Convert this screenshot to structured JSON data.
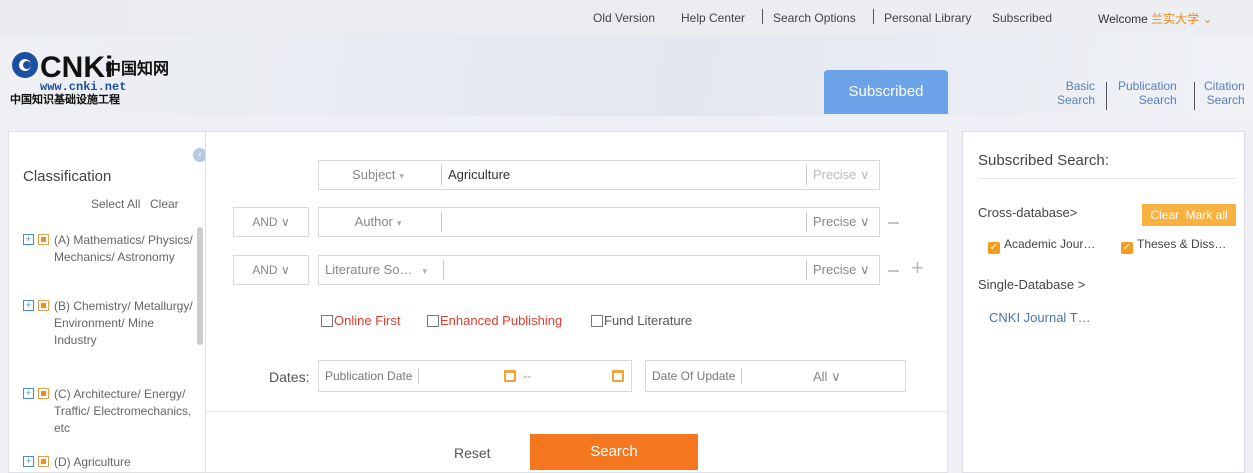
{
  "topbar": {
    "old_version": "Old Version",
    "help_center": "Help Center",
    "search_options": "Search Options",
    "personal_library": "Personal Library",
    "subscribed": "Subscribed",
    "welcome": "Welcome",
    "user": "兰实大学",
    "user_caret": "⌄"
  },
  "logo": {
    "brand": "CNKi",
    "chinese_name": "中国知网",
    "url": "www.cnki.net",
    "subtitle": "中国知识基础设施工程"
  },
  "header": {
    "active_tab": "Subscribed",
    "nav": [
      {
        "line1": "Basic",
        "line2": "Search"
      },
      {
        "line1": "Publication",
        "line2": "Search"
      },
      {
        "line1": "Citation",
        "line2": "Search"
      }
    ]
  },
  "classification": {
    "title": "Classification",
    "select_all": "Select All",
    "clear": "Clear",
    "items": [
      {
        "code": "(A)",
        "label": "(A) Mathematics/ Physics/ Mechanics/ Astronomy"
      },
      {
        "code": "(B)",
        "label": "(B) Chemistry/ Metallurgy/ Environment/ Mine Industry"
      },
      {
        "code": "(C)",
        "label": "(C) Architecture/ Energy/ Traffic/ Electromechanics, etc"
      },
      {
        "code": "(D)",
        "label": "(D) Agriculture"
      }
    ]
  },
  "search": {
    "rows": [
      {
        "logic": "",
        "field": "Subject",
        "value": "Agriculture",
        "match": "Precise"
      },
      {
        "logic": "AND",
        "field": "Author",
        "value": "",
        "match": "Precise"
      },
      {
        "logic": "AND",
        "field": "Literature So…",
        "value": "",
        "match": "Precise"
      }
    ],
    "options": {
      "online_first": "Online First",
      "enhanced_publishing": "Enhanced Publishing",
      "fund_literature": "Fund Literature"
    },
    "dates": {
      "label": "Dates:",
      "publication_date": "Publication Date",
      "dash": "--",
      "date_of_update": "Date Of Update",
      "all": "All"
    },
    "reset": "Reset",
    "submit": "Search"
  },
  "subscribed_panel": {
    "title": "Subscribed Search:",
    "cross_database": "Cross-database>",
    "clear": "Clear",
    "mark_all": "Mark all",
    "databases": [
      "Academic Jour…",
      "Theses & Diss…"
    ],
    "single_database": "Single-Database >",
    "journal": "CNKI Journal T…"
  },
  "colors": {
    "accent_orange": "#f4761f",
    "tab_blue": "#6ba2e8",
    "link_blue": "#4a74b4"
  }
}
